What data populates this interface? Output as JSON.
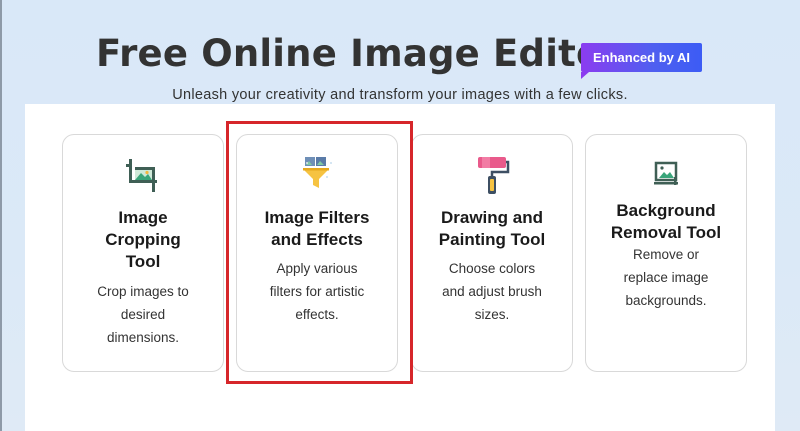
{
  "header": {
    "title": "Free Online Image Editor",
    "badge": "Enhanced by AI",
    "subtitle": "Unleash your creativity and transform your images with a few clicks."
  },
  "cards": [
    {
      "icon": "crop-icon",
      "title_lines": [
        "Image",
        "Cropping",
        "Tool"
      ],
      "desc_lines": [
        "Crop images to",
        "desired",
        "dimensions."
      ]
    },
    {
      "icon": "image-filter-icon",
      "title_lines": [
        "Image Filters",
        "and Effects"
      ],
      "desc_lines": [
        "Apply various",
        "filters for artistic",
        "effects."
      ]
    },
    {
      "icon": "paint-roller-icon",
      "title_lines": [
        "Drawing and",
        "Painting Tool"
      ],
      "desc_lines": [
        "Choose colors",
        "and adjust brush",
        "sizes."
      ]
    },
    {
      "icon": "background-removal-icon",
      "title_lines": [
        "Background",
        "Removal Tool"
      ],
      "desc_lines": [
        "Remove or",
        "replace image",
        "backgrounds."
      ]
    }
  ],
  "colors": {
    "highlight": "#d6262a",
    "badge_start": "#8b3cf0",
    "badge_end": "#3c5cf5"
  }
}
